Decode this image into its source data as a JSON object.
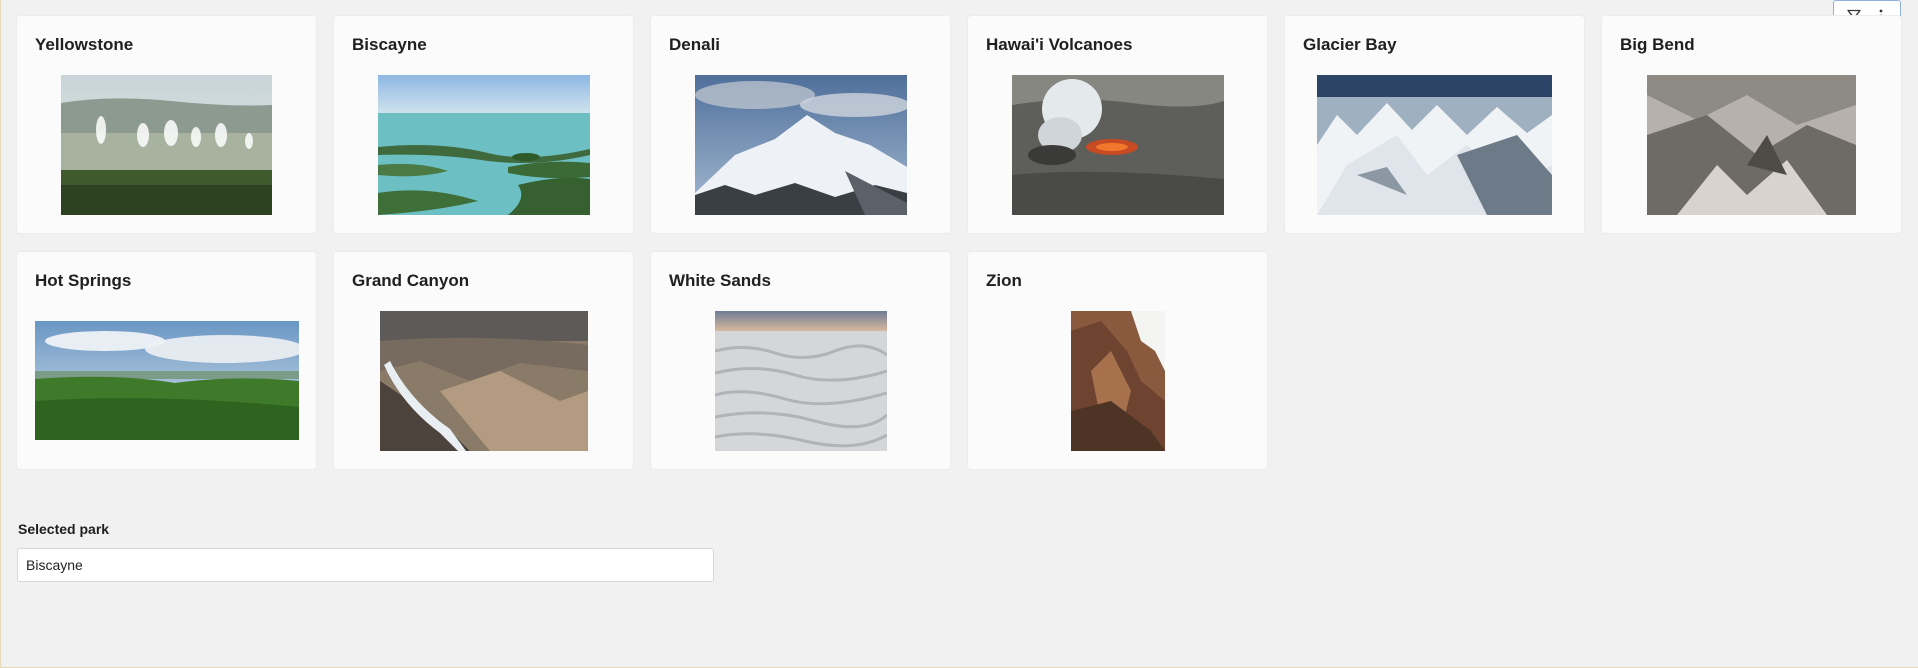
{
  "toolbar": {
    "filter_icon": "filter-icon",
    "more_icon": "more-vertical-icon"
  },
  "parks": [
    {
      "name": "Yellowstone"
    },
    {
      "name": "Biscayne"
    },
    {
      "name": "Denali"
    },
    {
      "name": "Hawai'i Volcanoes"
    },
    {
      "name": "Glacier Bay"
    },
    {
      "name": "Big Bend"
    },
    {
      "name": "Hot Springs"
    },
    {
      "name": "Grand Canyon"
    },
    {
      "name": "White Sands"
    },
    {
      "name": "Zion"
    }
  ],
  "selection": {
    "label": "Selected park",
    "value": "Biscayne"
  },
  "colors": {
    "background": "#f1f1f1",
    "card": "#fbfbfb",
    "toolbar_border": "#8fb1da"
  }
}
